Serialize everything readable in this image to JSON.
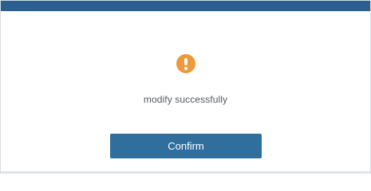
{
  "dialog": {
    "message": "modify successfully",
    "confirm_label": "Confirm",
    "icon": "exclamation-circle-icon"
  },
  "colors": {
    "title_bar": "#2a5f8f",
    "icon": "#ec9a3c",
    "button": "#2f6e9d",
    "message_text": "#555a5f"
  }
}
